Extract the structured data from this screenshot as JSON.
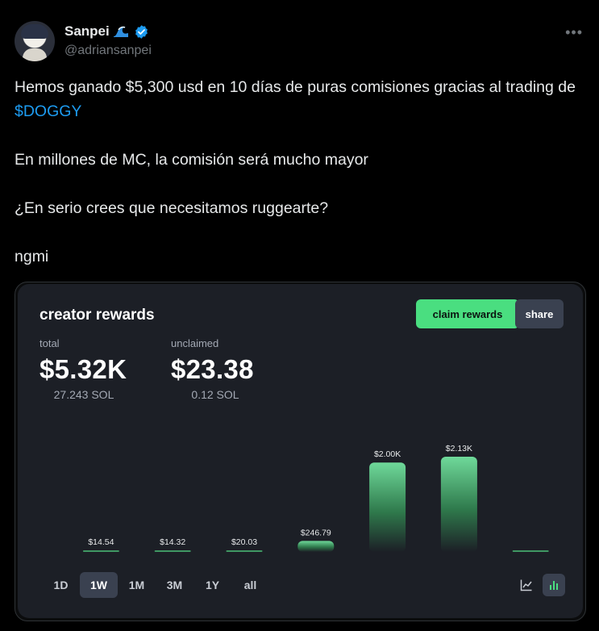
{
  "user": {
    "display_name": "Sanpei",
    "handle": "@adriansanpei",
    "name_icons": [
      "wave-icon",
      "verified-badge-icon"
    ]
  },
  "tweet": {
    "line1_before": "Hemos ganado $5,300 usd en 10 días de puras comisiones gracias al trading de ",
    "cashtag": "$DOGGY",
    "line2": "En millones de MC, la comisión será mucho mayor",
    "line3": "¿En serio crees que necesitamos ruggearte?",
    "line4": "ngmi"
  },
  "card": {
    "title": "creator rewards",
    "claim_label": "claim rewards",
    "share_label": "share",
    "total": {
      "label": "total",
      "value": "$5.32K",
      "sub": "27.243 SOL"
    },
    "unclaimed": {
      "label": "unclaimed",
      "value": "$23.38",
      "sub": "0.12 SOL"
    },
    "range_tabs": [
      "1D",
      "1W",
      "1M",
      "3M",
      "1Y",
      "all"
    ],
    "active_range": "1W",
    "view_icons": [
      "line-chart-icon",
      "bar-chart-icon"
    ],
    "active_view": "bar-chart-icon"
  },
  "colors": {
    "accent_green": "#4ade80",
    "cashtag_blue": "#1d9bf0",
    "verified_blue": "#1d9bf0",
    "panel_bg": "#1c1f26"
  },
  "chart_data": {
    "type": "bar",
    "values": [
      14.54,
      14.32,
      20.03,
      246.79,
      2000,
      2130,
      0
    ],
    "data_labels": [
      "$14.54",
      "$14.32",
      "$20.03",
      "$246.79",
      "$2.00K",
      "$2.13K",
      ""
    ],
    "ylim": [
      0,
      2130
    ]
  }
}
